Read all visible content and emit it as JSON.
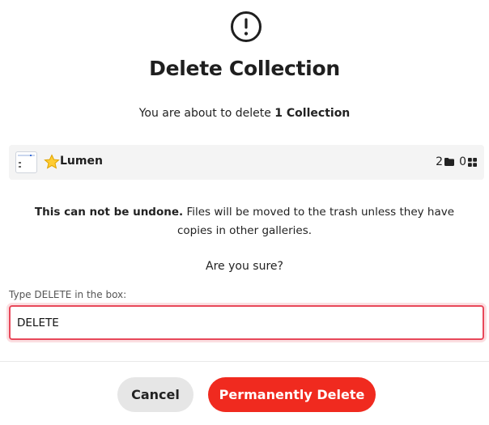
{
  "dialog": {
    "title": "Delete Collection",
    "subtitle_prefix": "You are about to delete ",
    "subtitle_count": "1 Collection",
    "icon": "exclamation-circle-icon"
  },
  "collection": {
    "name": "Lumen",
    "name_icon": "star-emoji",
    "folder_count": "2",
    "item_count": "0"
  },
  "warning": {
    "bold": "This can not be undone.",
    "rest": " Files will be moved to the trash unless they have copies in other galleries.",
    "question": "Are you sure?"
  },
  "confirm_field": {
    "label": "Type DELETE in the box:",
    "value": "DELETE"
  },
  "buttons": {
    "cancel": "Cancel",
    "delete": "Permanently Delete"
  },
  "colors": {
    "danger": "#f02a1f",
    "input_border": "#e8485a",
    "row_bg": "#f4f4f4"
  }
}
